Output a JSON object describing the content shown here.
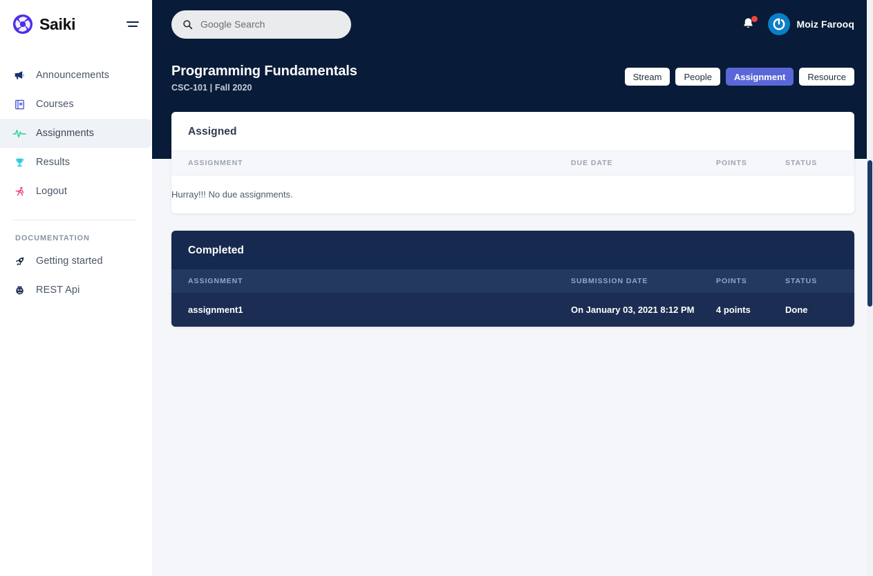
{
  "brand": {
    "name": "Saiki",
    "logo_icon": "aperture-logo-icon",
    "menu_icon": "hamburger-menu-icon"
  },
  "sidebar": {
    "items": [
      {
        "label": "Announcements",
        "icon": "megaphone-icon",
        "active": false
      },
      {
        "label": "Courses",
        "icon": "book-list-icon",
        "active": false
      },
      {
        "label": "Assignments",
        "icon": "activity-pulse-icon",
        "active": true
      },
      {
        "label": "Results",
        "icon": "trophy-icon",
        "active": false
      },
      {
        "label": "Logout",
        "icon": "running-person-icon",
        "active": false
      }
    ],
    "section_title": "DOCUMENTATION",
    "doc_items": [
      {
        "label": "Getting started",
        "icon": "rocket-icon"
      },
      {
        "label": "REST Api",
        "icon": "api-circle-icon"
      }
    ]
  },
  "topbar": {
    "search": {
      "placeholder": "Google Search",
      "value": "",
      "icon": "search-icon"
    },
    "notification_icon": "bell-icon",
    "has_notification": true,
    "user": {
      "name": "Moiz Farooq",
      "avatar_icon": "power-loop-avatar-icon"
    }
  },
  "course": {
    "title": "Programming Fundamentals",
    "subtitle": "CSC-101 | Fall 2020",
    "tabs": [
      {
        "label": "Stream",
        "active": false
      },
      {
        "label": "People",
        "active": false
      },
      {
        "label": "Assignment",
        "active": true
      },
      {
        "label": "Resource",
        "active": false
      }
    ]
  },
  "assigned": {
    "title": "Assigned",
    "columns": {
      "assignment": "ASSIGNMENT",
      "due_date": "DUE DATE",
      "points": "POINTS",
      "status": "STATUS"
    },
    "empty_message": "Hurray!!! No due assignments.",
    "rows": []
  },
  "completed": {
    "title": "Completed",
    "columns": {
      "assignment": "ASSIGNMENT",
      "submission_date": "SUBMISSION DATE",
      "points": "POINTS",
      "status": "STATUS"
    },
    "rows": [
      {
        "assignment": "assignment1",
        "submission_date": "On January 03, 2021 8:12 PM",
        "points": "4 points",
        "status": "Done"
      }
    ]
  },
  "colors": {
    "header_dark": "#081b38",
    "card_dark": "#16294e",
    "accent_tab": "#5a67d8",
    "status_done": "#12d17e",
    "page_bg": "#f4f6fa",
    "avatar_blue": "#0a7ec6",
    "notification_red": "#f0453a"
  }
}
